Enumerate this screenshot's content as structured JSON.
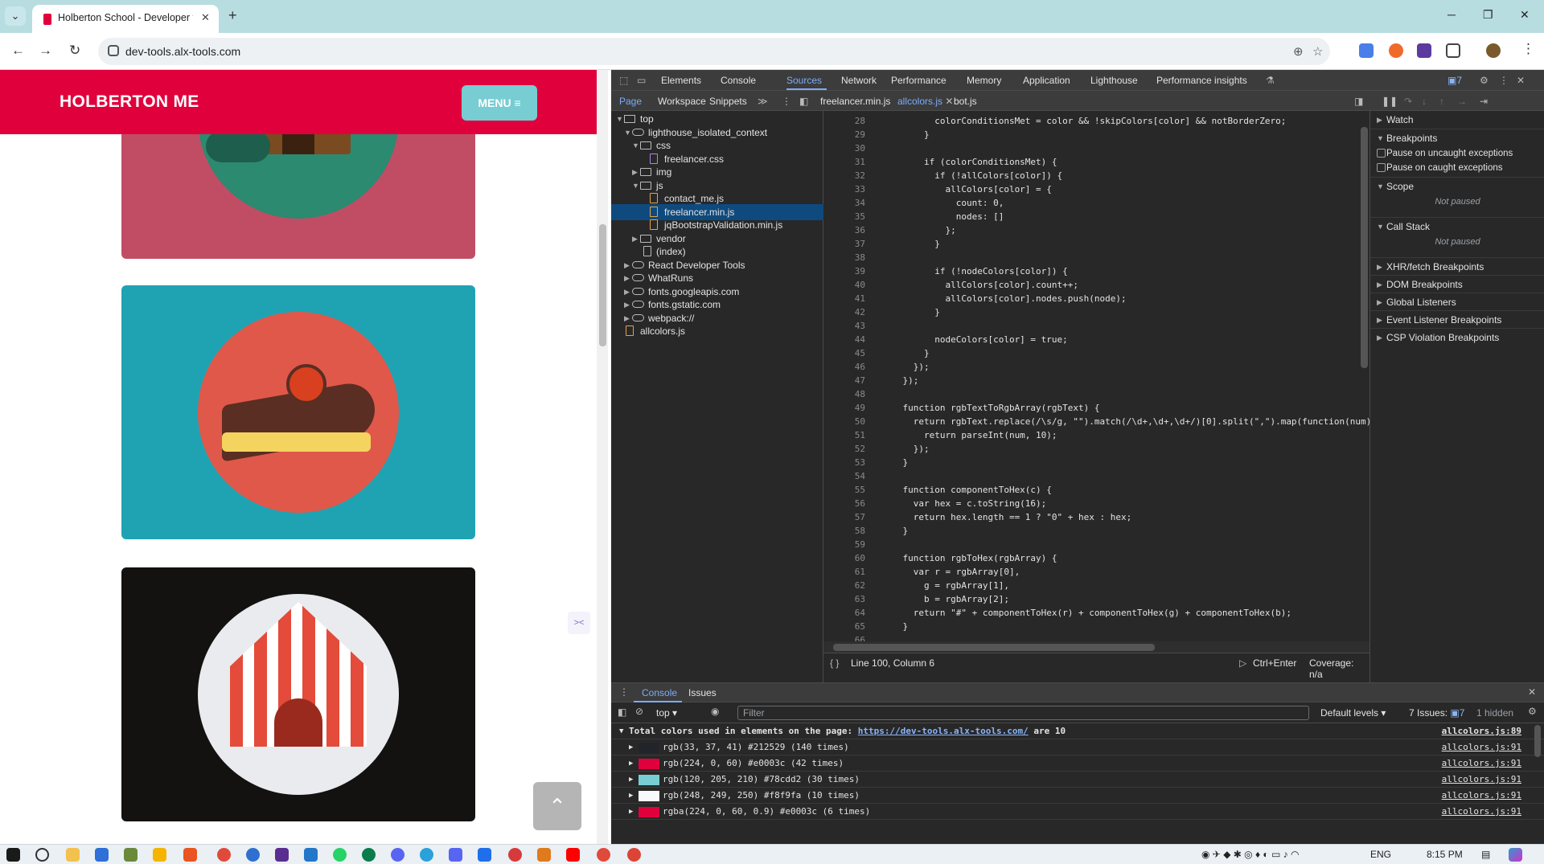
{
  "browser": {
    "tab_title": "Holberton School - Developer t",
    "url": "dev-tools.alx-tools.com"
  },
  "website": {
    "brand": "HOLBERTON ME",
    "menu_label": "MENU ≡",
    "colors": {
      "primary": "#e0003c",
      "accent": "#78cdd2",
      "card1": "#c14d65",
      "card2": "#1fa3b3",
      "card3": "#141111"
    }
  },
  "devtools": {
    "tabs": [
      "Elements",
      "Console",
      "Sources",
      "Network",
      "Performance",
      "Memory",
      "Application",
      "Lighthouse",
      "Performance insights"
    ],
    "issues_count": "7",
    "nav_tabs": [
      "Page",
      "Workspace",
      "Snippets"
    ],
    "editor_tabs": [
      "freelancer.min.js",
      "allcolors.js",
      "bot.js"
    ],
    "tree": [
      "top",
      "lighthouse_isolated_context",
      "css",
      "freelancer.css",
      "img",
      "js",
      "contact_me.js",
      "freelancer.min.js",
      "jqBootstrapValidation.min.js",
      "vendor",
      "(index)",
      "React Developer Tools",
      "WhatRuns",
      "fonts.googleapis.com",
      "fonts.gstatic.com",
      "webpack://",
      "allcolors.js"
    ],
    "code_lines": [
      {
        "n": "28",
        "t": "          colorConditionsMet = color && !skipColors[color] && notBorderZero;"
      },
      {
        "n": "29",
        "t": "        }"
      },
      {
        "n": "30",
        "t": ""
      },
      {
        "n": "31",
        "t": "        if (colorConditionsMet) {"
      },
      {
        "n": "32",
        "t": "          if (!allColors[color]) {"
      },
      {
        "n": "33",
        "t": "            allColors[color] = {"
      },
      {
        "n": "34",
        "t": "              count: 0,"
      },
      {
        "n": "35",
        "t": "              nodes: []"
      },
      {
        "n": "36",
        "t": "            };"
      },
      {
        "n": "37",
        "t": "          }"
      },
      {
        "n": "38",
        "t": ""
      },
      {
        "n": "39",
        "t": "          if (!nodeColors[color]) {"
      },
      {
        "n": "40",
        "t": "            allColors[color].count++;"
      },
      {
        "n": "41",
        "t": "            allColors[color].nodes.push(node);"
      },
      {
        "n": "42",
        "t": "          }"
      },
      {
        "n": "43",
        "t": ""
      },
      {
        "n": "44",
        "t": "          nodeColors[color] = true;"
      },
      {
        "n": "45",
        "t": "        }"
      },
      {
        "n": "46",
        "t": "      });"
      },
      {
        "n": "47",
        "t": "    });"
      },
      {
        "n": "48",
        "t": ""
      },
      {
        "n": "49",
        "t": "    function rgbTextToRgbArray(rgbText) {"
      },
      {
        "n": "50",
        "t": "      return rgbText.replace(/\\s/g, \"\").match(/\\d+,\\d+,\\d+/)[0].split(\",\").map(function(num) {"
      },
      {
        "n": "51",
        "t": "        return parseInt(num, 10);"
      },
      {
        "n": "52",
        "t": "      });"
      },
      {
        "n": "53",
        "t": "    }"
      },
      {
        "n": "54",
        "t": ""
      },
      {
        "n": "55",
        "t": "    function componentToHex(c) {"
      },
      {
        "n": "56",
        "t": "      var hex = c.toString(16);"
      },
      {
        "n": "57",
        "t": "      return hex.length == 1 ? \"0\" + hex : hex;"
      },
      {
        "n": "58",
        "t": "    }"
      },
      {
        "n": "59",
        "t": ""
      },
      {
        "n": "60",
        "t": "    function rgbToHex(rgbArray) {"
      },
      {
        "n": "61",
        "t": "      var r = rgbArray[0],"
      },
      {
        "n": "62",
        "t": "        g = rgbArray[1],"
      },
      {
        "n": "63",
        "t": "        b = rgbArray[2];"
      },
      {
        "n": "64",
        "t": "      return \"#\" + componentToHex(r) + componentToHex(g) + componentToHex(b);"
      },
      {
        "n": "65",
        "t": "    }"
      },
      {
        "n": "66",
        "t": ""
      }
    ],
    "cursor_position": "Line 100, Column 6",
    "run_hint": "Ctrl+Enter",
    "coverage": "Coverage: n/a",
    "debugger": {
      "watch": "Watch",
      "breakpoints": "Breakpoints",
      "pause_uncaught": "Pause on uncaught exceptions",
      "pause_caught": "Pause on caught exceptions",
      "scope": "Scope",
      "not_paused": "Not paused",
      "call_stack": "Call Stack",
      "sections": [
        "XHR/fetch Breakpoints",
        "DOM Breakpoints",
        "Global Listeners",
        "Event Listener Breakpoints",
        "CSP Violation Breakpoints"
      ]
    },
    "console": {
      "tabs": [
        "Console",
        "Issues"
      ],
      "context": "top",
      "filter_placeholder": "Filter",
      "levels": "Default levels",
      "issues": "7 Issues:",
      "issues_count": "7",
      "hidden": "1 hidden",
      "summary_prefix": "Total colors used in elements on the page: ",
      "summary_link": "https://dev-tools.alx-tools.com/",
      "summary_suffix": " are 10",
      "summary_source": "allcolors.js:89",
      "rows": [
        {
          "text": "rgb(33, 37, 41) #212529 (140 times)",
          "color": "#212529",
          "source": "allcolors.js:91"
        },
        {
          "text": "rgb(224, 0, 60) #e0003c (42 times)",
          "color": "#e0003c",
          "source": "allcolors.js:91"
        },
        {
          "text": "rgb(120, 205, 210) #78cdd2 (30 times)",
          "color": "#78cdd2",
          "source": "allcolors.js:91"
        },
        {
          "text": "rgb(248, 249, 250) #f8f9fa (10 times)",
          "color": "#f8f9fa",
          "source": "allcolors.js:91"
        },
        {
          "text": "rgba(224, 0, 60, 0.9) #e0003c (6 times)",
          "color": "#e0003c",
          "source": "allcolors.js:91"
        }
      ]
    }
  },
  "taskbar": {
    "language": "ENG",
    "time": "8:15 PM"
  }
}
